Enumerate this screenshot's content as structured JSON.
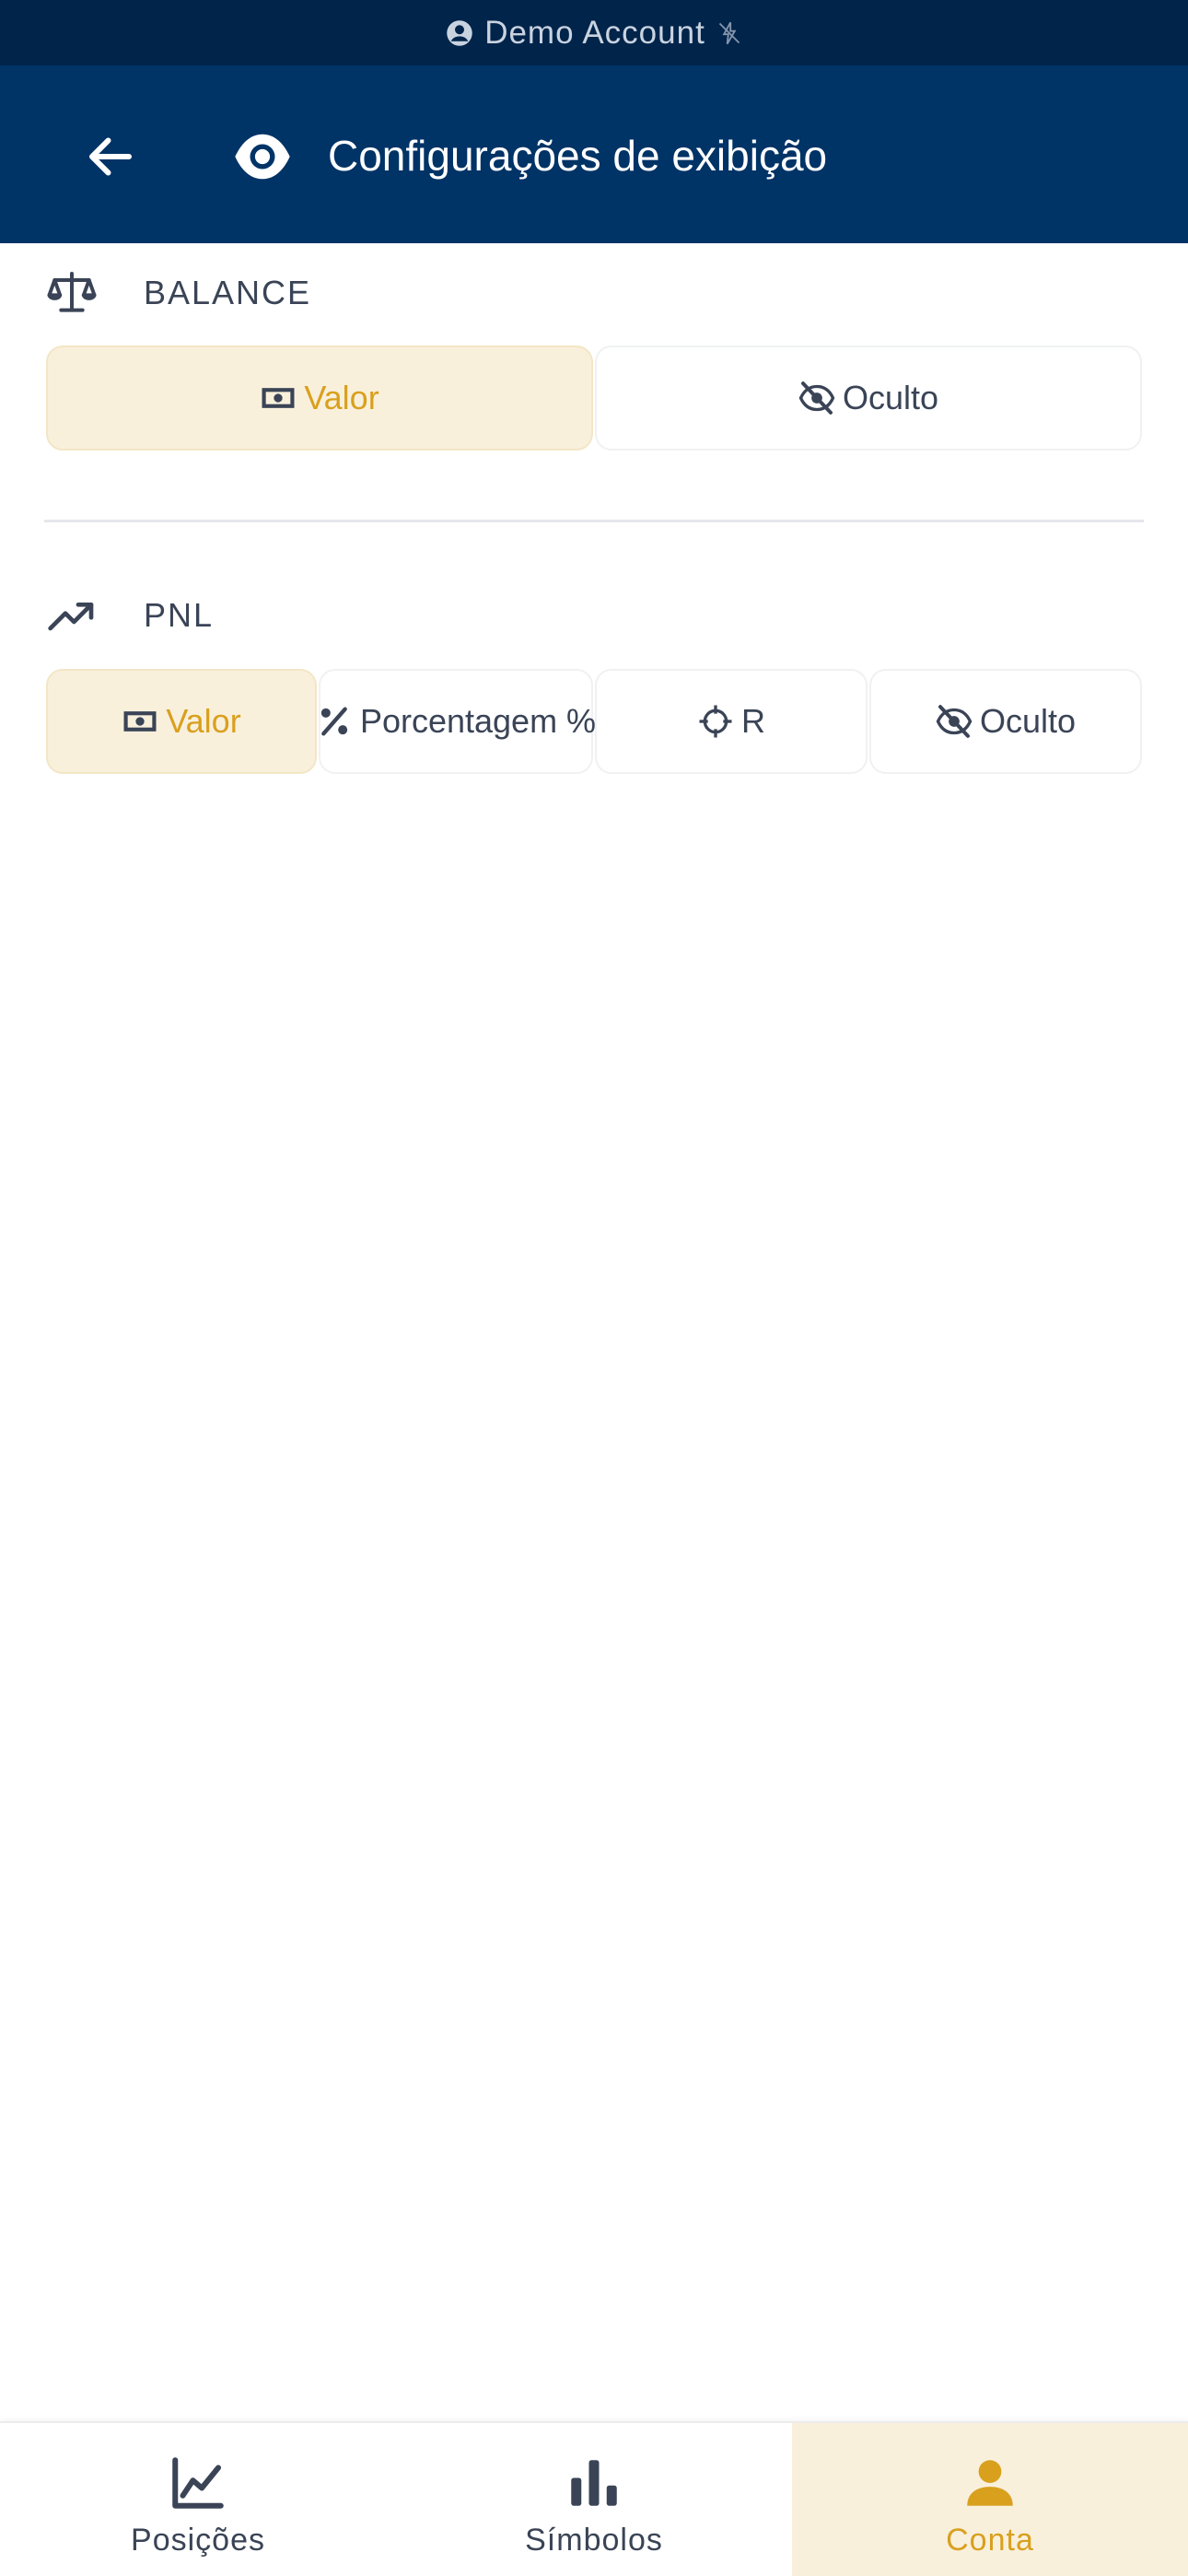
{
  "status_bar": {
    "label": "Demo Account"
  },
  "app_bar": {
    "title": "Configurações de exibição"
  },
  "balance": {
    "label": "BALANCE",
    "options": [
      {
        "label": "Valor",
        "icon": "money-icon",
        "selected": true
      },
      {
        "label": "Oculto",
        "icon": "eye-off-icon",
        "selected": false
      }
    ]
  },
  "pnl": {
    "label": "PNL",
    "options": [
      {
        "label": "Valor",
        "icon": "money-icon",
        "selected": true
      },
      {
        "label": "Porcentagem %",
        "icon": "percent-icon",
        "selected": false
      },
      {
        "label": "R",
        "icon": "crosshair-icon",
        "selected": false
      },
      {
        "label": "Oculto",
        "icon": "eye-off-icon",
        "selected": false
      }
    ]
  },
  "bottom_nav": {
    "items": [
      {
        "label": "Posições",
        "icon": "chart-line-icon",
        "active": false
      },
      {
        "label": "Símbolos",
        "icon": "bar-chart-icon",
        "active": false
      },
      {
        "label": "Conta",
        "icon": "person-icon",
        "active": true
      }
    ]
  },
  "colors": {
    "statusbar": "#00244a",
    "appbar": "#003366",
    "accent": "#d9a01e",
    "selected_bg": "#f9f0dc"
  }
}
